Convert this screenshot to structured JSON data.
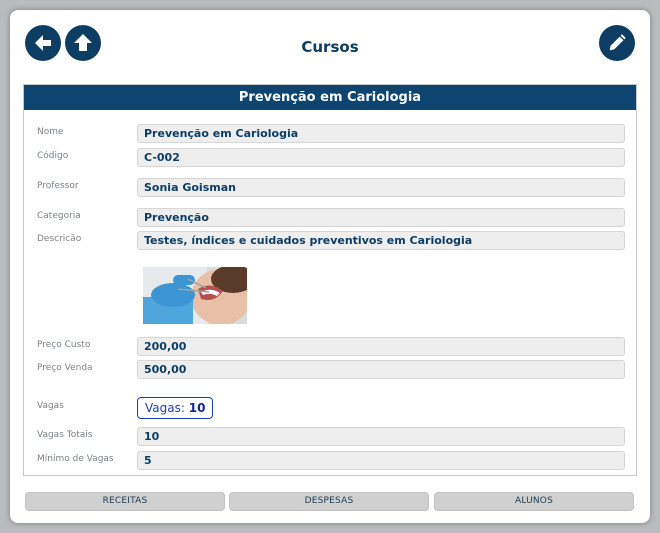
{
  "header": {
    "title": "Cursos",
    "back_icon": "arrow-left-icon",
    "up_icon": "arrow-up-icon",
    "edit_icon": "pencil-icon"
  },
  "panel": {
    "title": "Prevenção em Cariologia"
  },
  "fields": {
    "nome": {
      "label": "Nome",
      "value": "Prevenção em Cariologia"
    },
    "codigo": {
      "label": "Código",
      "value": "C-002"
    },
    "professor": {
      "label": "Professor",
      "value": "Sonia Goisman"
    },
    "categoria": {
      "label": "Categoria",
      "value": "Prevenção"
    },
    "descricao": {
      "label": "Descricão",
      "value": "Testes, índices e cuidados preventivos em Cariologia"
    },
    "preco_custo": {
      "label": "Preço Custo",
      "value": "200,00"
    },
    "preco_venda": {
      "label": "Preço Venda",
      "value": "500,00"
    },
    "vagas": {
      "label": "Vagas",
      "prefix": "Vagas:",
      "value": "10"
    },
    "vagas_totais": {
      "label": "Vagas Totais",
      "value": "10"
    },
    "minimo_vagas": {
      "label": "Mínimo de Vagas",
      "value": "5"
    }
  },
  "footer": {
    "receitas": "RECEITAS",
    "despesas": "DESPESAS",
    "alunos": "ALUNOS"
  },
  "colors": {
    "primary": "#0d3d63",
    "header_bar": "#0d4470",
    "vagas_accent": "#1f3fb0"
  }
}
